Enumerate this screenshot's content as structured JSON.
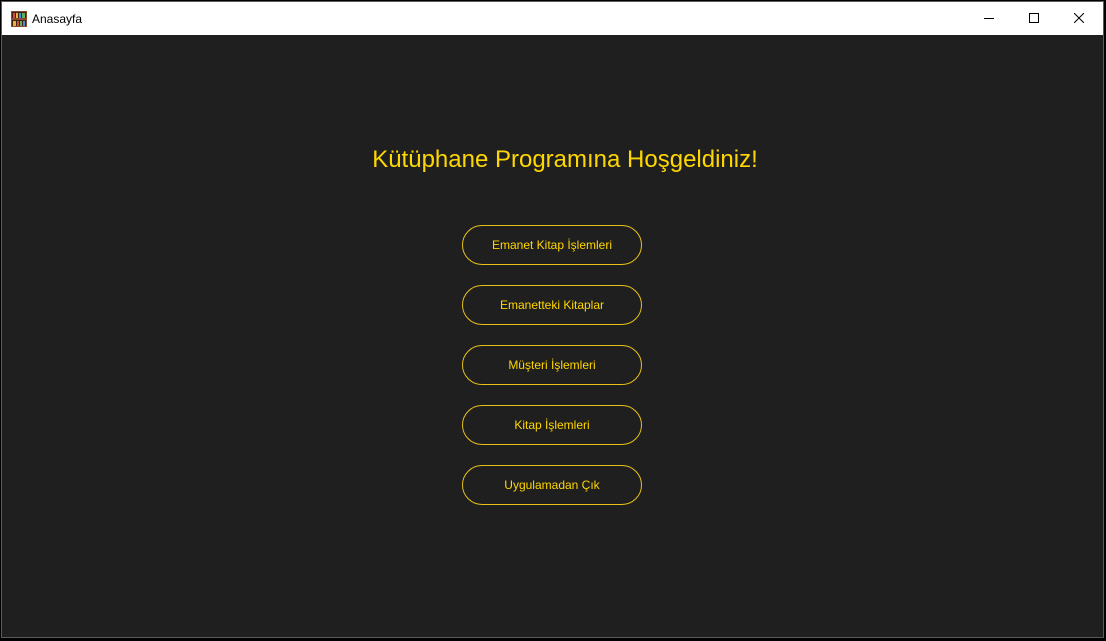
{
  "window": {
    "title": "Anasayfa",
    "app_icon": "bookshelf-icon",
    "controls": {
      "minimize_icon": "minimize-icon",
      "maximize_icon": "maximize-icon",
      "close_icon": "close-icon"
    }
  },
  "main": {
    "heading": "Kütüphane Programına Hoşgeldiniz!",
    "buttons": [
      {
        "label": "Emanet Kitap İşlemleri"
      },
      {
        "label": "Emanetteki Kitaplar"
      },
      {
        "label": "Müşteri İşlemleri"
      },
      {
        "label": "Kitap İşlemleri"
      },
      {
        "label": "Uygulamadan Çık"
      }
    ]
  },
  "colors": {
    "background": "#1f1f1f",
    "accent": "#ffd700",
    "button_border": "#e8c21a",
    "titlebar": "#ffffff"
  }
}
